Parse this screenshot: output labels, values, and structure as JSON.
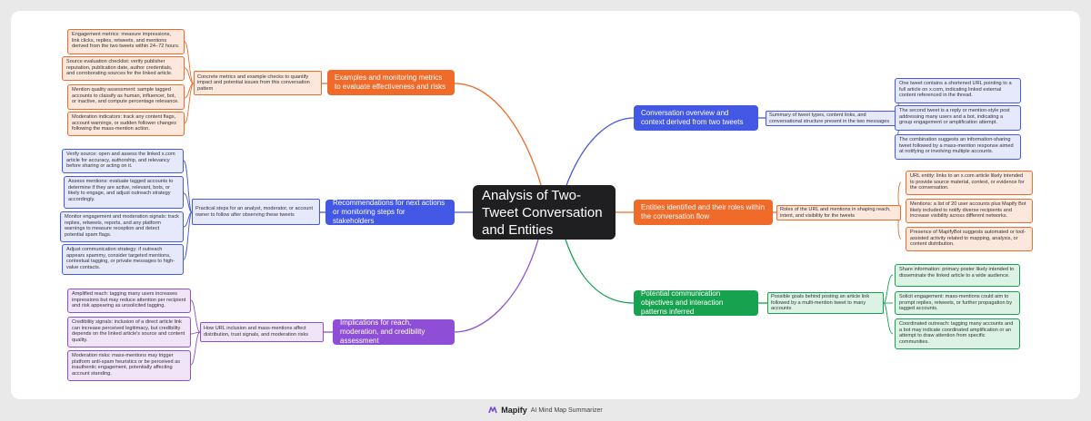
{
  "root": {
    "title": "Analysis of Two-Tweet Conversation and Entities"
  },
  "branches": [
    {
      "label": "Examples and monitoring metrics to evaluate effectiveness and risks",
      "summary": "Concrete metrics and example checks to quantify impact and potential issues from this conversation pattern",
      "leaves": [
        "Engagement metrics: measure impressions, link clicks, replies, retweets, and mentions derived from the two tweets within 24–72 hours.",
        "Source evaluation checklist: verify publisher reputation, publication date, author credentials, and corroborating sources for the linked article.",
        "Mention quality assessment: sample tagged accounts to classify as human, influencer, bot, or inactive, and compute percentage relevance.",
        "Moderation indicators: track any content flags, account warnings, or sudden follower changes following the mass-mention action."
      ]
    },
    {
      "label": "Recommendations for next actions or monitoring steps for stakeholders",
      "summary": "Practical steps for an analyst, moderator, or account owner to follow after observing these tweets",
      "leaves": [
        "Verify source: open and assess the linked x.com article for accuracy, authorship, and relevancy before sharing or acting on it.",
        "Assess mentions: evaluate tagged accounts to determine if they are active, relevant, bots, or likely to engage, and adjust outreach strategy accordingly.",
        "Monitor engagement and moderation signals: track replies, retweets, reports, and any platform warnings to measure reception and detect potential spam flags.",
        "Adjust communication strategy: if outreach appears spammy, consider targeted mentions, contextual tagging, or private messages to high-value contacts."
      ]
    },
    {
      "label": "Implications for reach, moderation, and credibility assessment",
      "summary": "How URL inclusion and mass-mentions affect distribution, trust signals, and moderation risks",
      "leaves": [
        "Amplified reach: tagging many users increases impressions but may reduce attention per recipient and risk appearing as unsolicited tagging.",
        "Credibility signals: inclusion of a direct article link can increase perceived legitimacy, but credibility depends on the linked article's source and content quality.",
        "Moderation risks: mass-mentions may trigger platform anti-spam heuristics or be perceived as inauthentic engagement, potentially affecting account standing."
      ]
    },
    {
      "label": "Conversation overview and context derived from two tweets",
      "summary": "Summary of tweet types, content links, and conversational structure present in the two messages",
      "leaves": [
        "One tweet contains a shortened URL pointing to a full article on x.com, indicating linked external content referenced in the thread.",
        "The second tweet is a reply or mention-style post addressing many users and a bot, indicating a group engagement or amplification attempt.",
        "The combination suggests an information-sharing tweet followed by a mass-mention response aimed at notifying or involving multiple accounts."
      ]
    },
    {
      "label": "Entities identified and their roles within the conversation flow",
      "summary": "Roles of the URL and mentions in shaping reach, intent, and visibility for the tweets",
      "leaves": [
        "URL entity: links to an x.com article likely intended to provide source material, context, or evidence for the conversation.",
        "Mentions: a list of 20 user accounts plus Mapify Bot likely included to notify diverse recipients and increase visibility across different networks.",
        "Presence of MapifyBot suggests automated or tool-assisted activity related to mapping, analysis, or content distribution."
      ]
    },
    {
      "label": "Potential communication objectives and interaction patterns inferred",
      "summary": "Possible goals behind posting an article link followed by a multi-mention tweet to many accounts",
      "leaves": [
        "Share information: primary poster likely intended to disseminate the linked article to a wide audience.",
        "Solicit engagement: mass-mentions could aim to prompt replies, retweets, or further propagation by tagged accounts.",
        "Coordinated outreach: tagging many accounts and a bot may indicate coordinated amplification or an attempt to draw attention from specific communities."
      ]
    }
  ],
  "colors": {
    "orange": "#f06a2a",
    "blue": "#4458e6",
    "purple": "#8e4fd6",
    "green": "#17a24f"
  },
  "footer": {
    "logo_icon": "mapify-logo-icon",
    "brand": "Mapify",
    "tagline": "AI Mind Map Summarizer"
  }
}
